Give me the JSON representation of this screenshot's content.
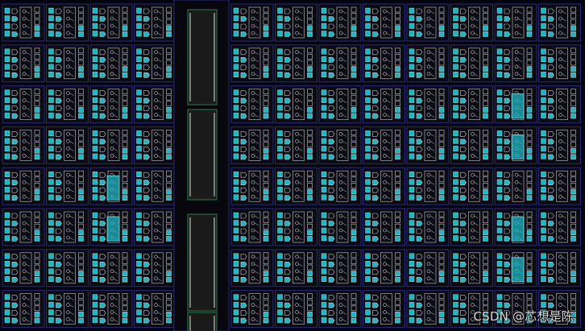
{
  "layout_view": {
    "description_tag": "tile-array",
    "column_groups": [
      "left",
      "right"
    ],
    "columns_per_group": [
      4,
      8
    ],
    "rows_visible": 8,
    "highlighted_tiles": [
      {
        "group": "left",
        "col": 2,
        "row": 4
      },
      {
        "group": "left",
        "col": 2,
        "row": 5
      },
      {
        "group": "right",
        "col": 6,
        "row": 2
      },
      {
        "group": "right",
        "col": 6,
        "row": 3
      },
      {
        "group": "right",
        "col": 6,
        "row": 5
      },
      {
        "group": "right",
        "col": 6,
        "row": 6
      }
    ],
    "channel_segments": 3
  },
  "colors": {
    "background": "#05050f",
    "tile_border": "#2a2a78",
    "tile_fill": "#0b0b14",
    "cell_outline": "#c8c8c8",
    "accent": "#1fb6c2",
    "channel_fill": "#1a1a1a",
    "channel_border": "#2c7a52"
  },
  "watermark": {
    "text": "CSDN @芯想是陈"
  }
}
